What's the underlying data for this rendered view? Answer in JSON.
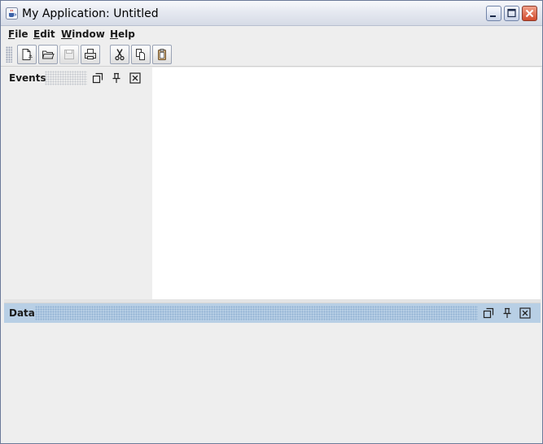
{
  "window": {
    "title": "My Application: Untitled",
    "icon": "java-cup-icon",
    "controls": [
      {
        "name": "minimize-button",
        "icon": "minimize-icon"
      },
      {
        "name": "maximize-button",
        "icon": "maximize-icon"
      },
      {
        "name": "close-button",
        "icon": "close-icon"
      }
    ]
  },
  "menubar": {
    "items": [
      {
        "label": "File",
        "mnemonic": "F"
      },
      {
        "label": "Edit",
        "mnemonic": "E"
      },
      {
        "label": "Window",
        "mnemonic": "W"
      },
      {
        "label": "Help",
        "mnemonic": "H"
      }
    ]
  },
  "toolbar": {
    "buttons": [
      {
        "name": "new-button",
        "icon": "new-document-icon",
        "enabled": true
      },
      {
        "name": "open-button",
        "icon": "open-folder-icon",
        "enabled": true
      },
      {
        "name": "save-button",
        "icon": "save-icon",
        "enabled": false
      },
      {
        "name": "print-button",
        "icon": "print-icon",
        "enabled": true
      },
      {
        "name": "cut-button",
        "icon": "scissors-icon",
        "enabled": true
      },
      {
        "name": "copy-button",
        "icon": "copy-icon",
        "enabled": true
      },
      {
        "name": "paste-button",
        "icon": "paste-icon",
        "enabled": true
      }
    ]
  },
  "panels": {
    "events": {
      "title": "Events",
      "buttons": [
        "float-icon",
        "pin-icon",
        "close-icon"
      ]
    },
    "data": {
      "title": "Data",
      "buttons": [
        "float-icon",
        "pin-icon",
        "close-icon"
      ]
    }
  },
  "colors": {
    "data_header": "#b8cfe5",
    "panel_background": "#eeeeee",
    "editor_background": "#ffffff",
    "close_button": "#d24a2c"
  }
}
